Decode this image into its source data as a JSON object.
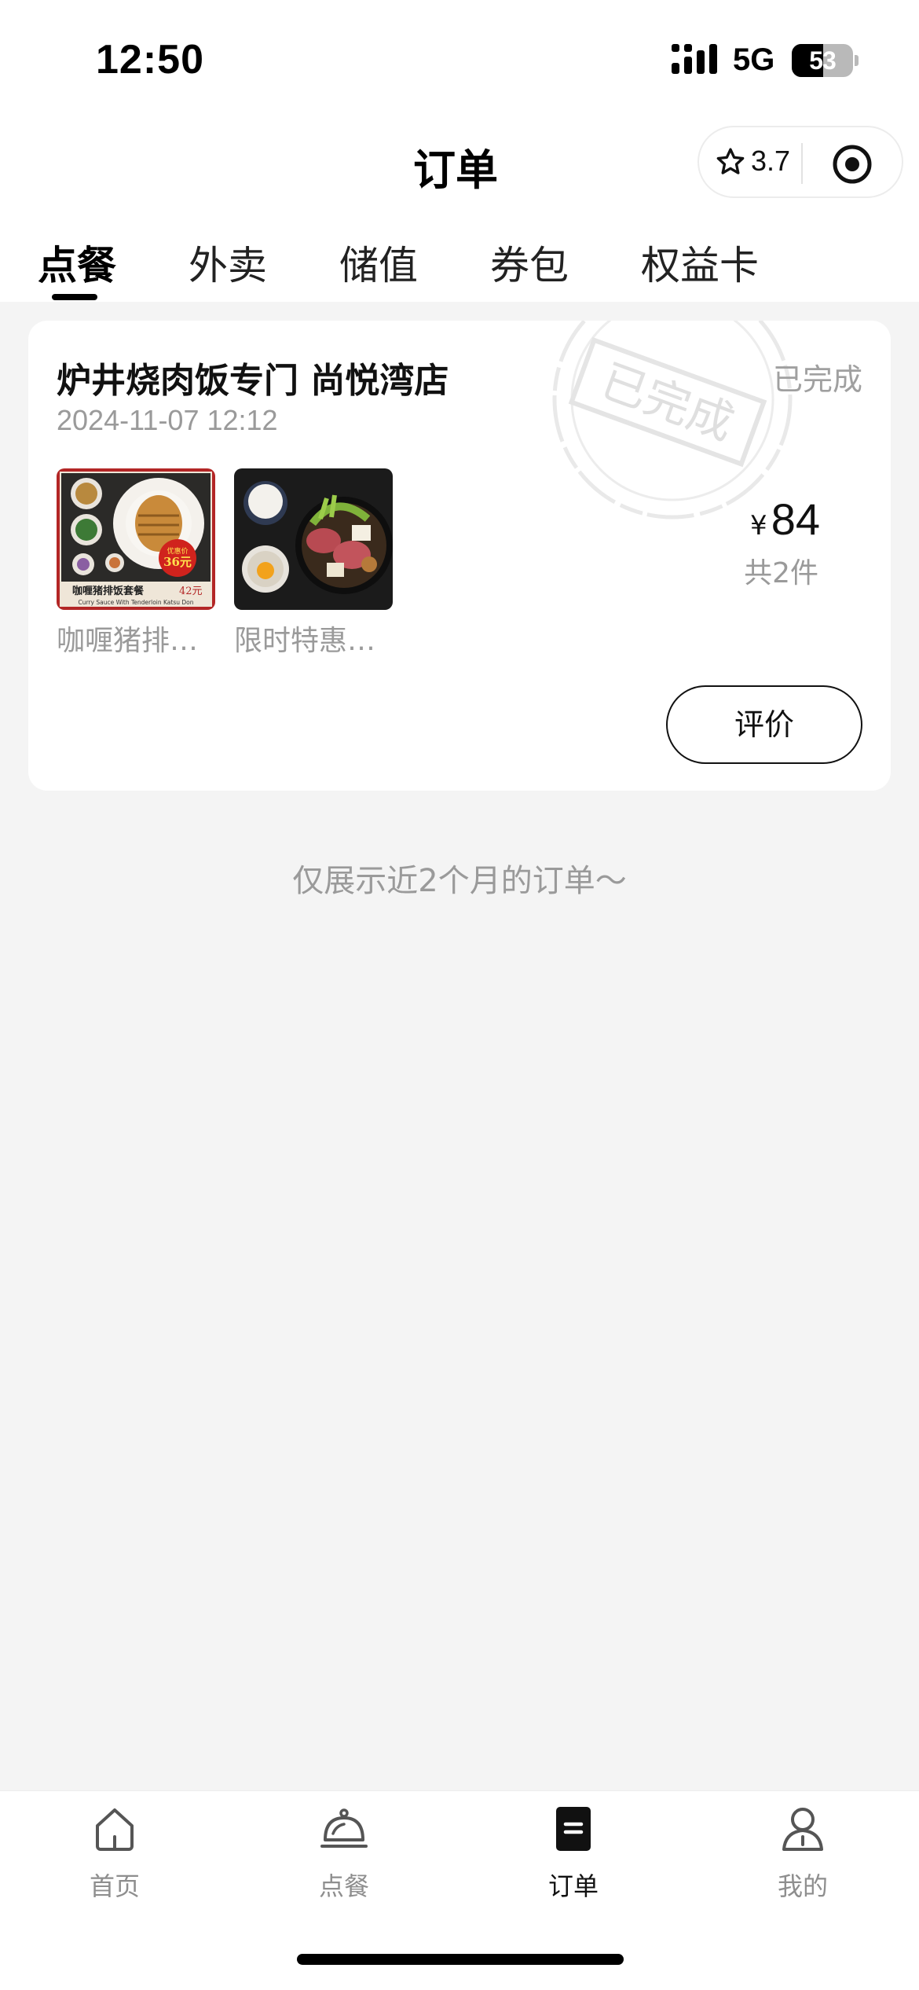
{
  "status_bar": {
    "time": "12:50",
    "network": "5G",
    "battery": "53"
  },
  "header": {
    "title": "订单",
    "rating": "3.7",
    "icons": [
      "star-icon",
      "target-icon"
    ]
  },
  "tabs": [
    {
      "label": "点餐",
      "active": true
    },
    {
      "label": "外卖",
      "active": false
    },
    {
      "label": "储值",
      "active": false
    },
    {
      "label": "券包",
      "active": false
    },
    {
      "label": "权益卡",
      "active": false
    }
  ],
  "order": {
    "store": "炉井烧肉饭专门 尚悦湾店",
    "time": "2024-11-07 12:12",
    "status": "已完成",
    "stamp_text": "已完成",
    "currency": "¥",
    "price": "84",
    "count": "共2件",
    "items": [
      {
        "name": "咖喱猪排…",
        "image_text": {
          "badge_top": "优惠价",
          "badge_price": "36元",
          "title": "咖喱猪排饭套餐",
          "price": "42元",
          "subtitle": "Curry Sauce With Tenderloin Katsu Don"
        }
      },
      {
        "name": "限时特惠…"
      }
    ],
    "review_button": "评价"
  },
  "footer_note": "仅展示近2个月的订单～",
  "tabbar": [
    {
      "label": "首页",
      "icon": "home-icon",
      "active": false
    },
    {
      "label": "点餐",
      "icon": "cloche-icon",
      "active": false
    },
    {
      "label": "订单",
      "icon": "order-list-icon",
      "active": true
    },
    {
      "label": "我的",
      "icon": "person-icon",
      "active": false
    }
  ],
  "colors": {
    "background": "#f4f4f4",
    "card": "#ffffff",
    "text": "#111111",
    "muted": "#9a9a9a"
  }
}
